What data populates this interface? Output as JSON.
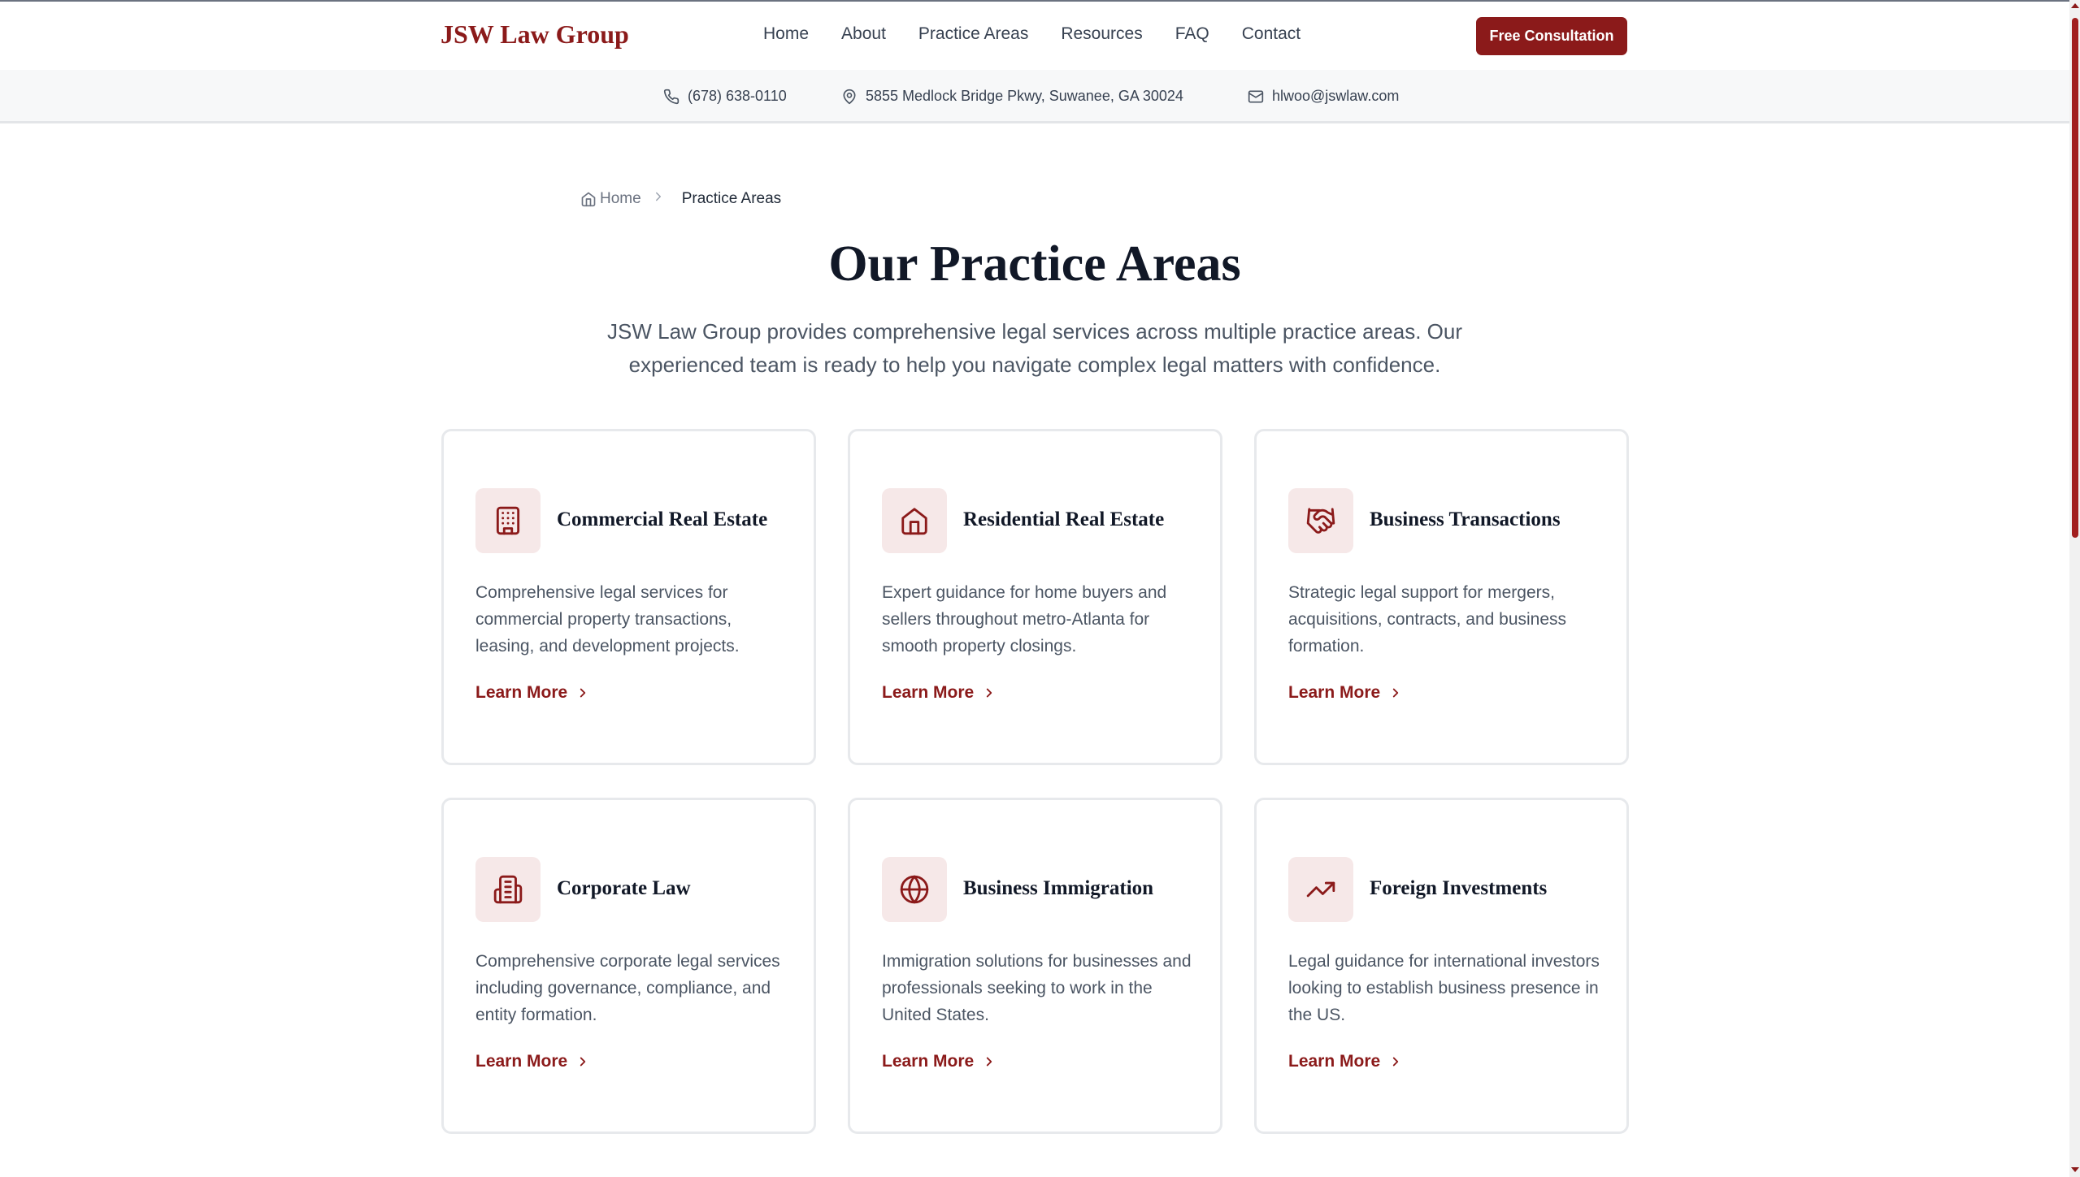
{
  "header": {
    "logo": "JSW Law Group",
    "nav": [
      "Home",
      "About",
      "Practice Areas",
      "Resources",
      "FAQ",
      "Contact"
    ],
    "cta_label": "Free Consultation"
  },
  "contact": {
    "phone": "(678) 638-0110",
    "address": "5855 Medlock Bridge Pkwy, Suwanee, GA 30024",
    "email": "hlwoo@jswlaw.com"
  },
  "breadcrumb": {
    "home": "Home",
    "current": "Practice Areas"
  },
  "page": {
    "title": "Our Practice Areas",
    "intro": "JSW Law Group provides comprehensive legal services across multiple practice areas. Our experienced team is ready to help you navigate complex legal matters with confidence."
  },
  "cards": [
    {
      "icon": "building-icon",
      "title": "Commercial Real Estate",
      "description": "Comprehensive legal services for commercial property transactions, leasing, and development projects.",
      "link": "Learn More"
    },
    {
      "icon": "house-icon",
      "title": "Residential Real Estate",
      "description": "Expert guidance for home buyers and sellers throughout metro-Atlanta for smooth property closings.",
      "link": "Learn More"
    },
    {
      "icon": "handshake-icon",
      "title": "Business Transactions",
      "description": "Strategic legal support for mergers, acquisitions, contracts, and business formation.",
      "link": "Learn More"
    },
    {
      "icon": "office-building-icon",
      "title": "Corporate Law",
      "description": "Comprehensive corporate legal services including governance, compliance, and entity formation.",
      "link": "Learn More"
    },
    {
      "icon": "globe-icon",
      "title": "Business Immigration",
      "description": "Immigration solutions for businesses and professionals seeking to work in the United States.",
      "link": "Learn More"
    },
    {
      "icon": "trending-up-icon",
      "title": "Foreign Investments",
      "description": "Legal guidance for international investors looking to establish business presence in the US.",
      "link": "Learn More"
    }
  ],
  "colors": {
    "brand": "#8b1a1a",
    "icon_background": "#f6e8e8",
    "contact_bar": "#f7f8f9"
  }
}
